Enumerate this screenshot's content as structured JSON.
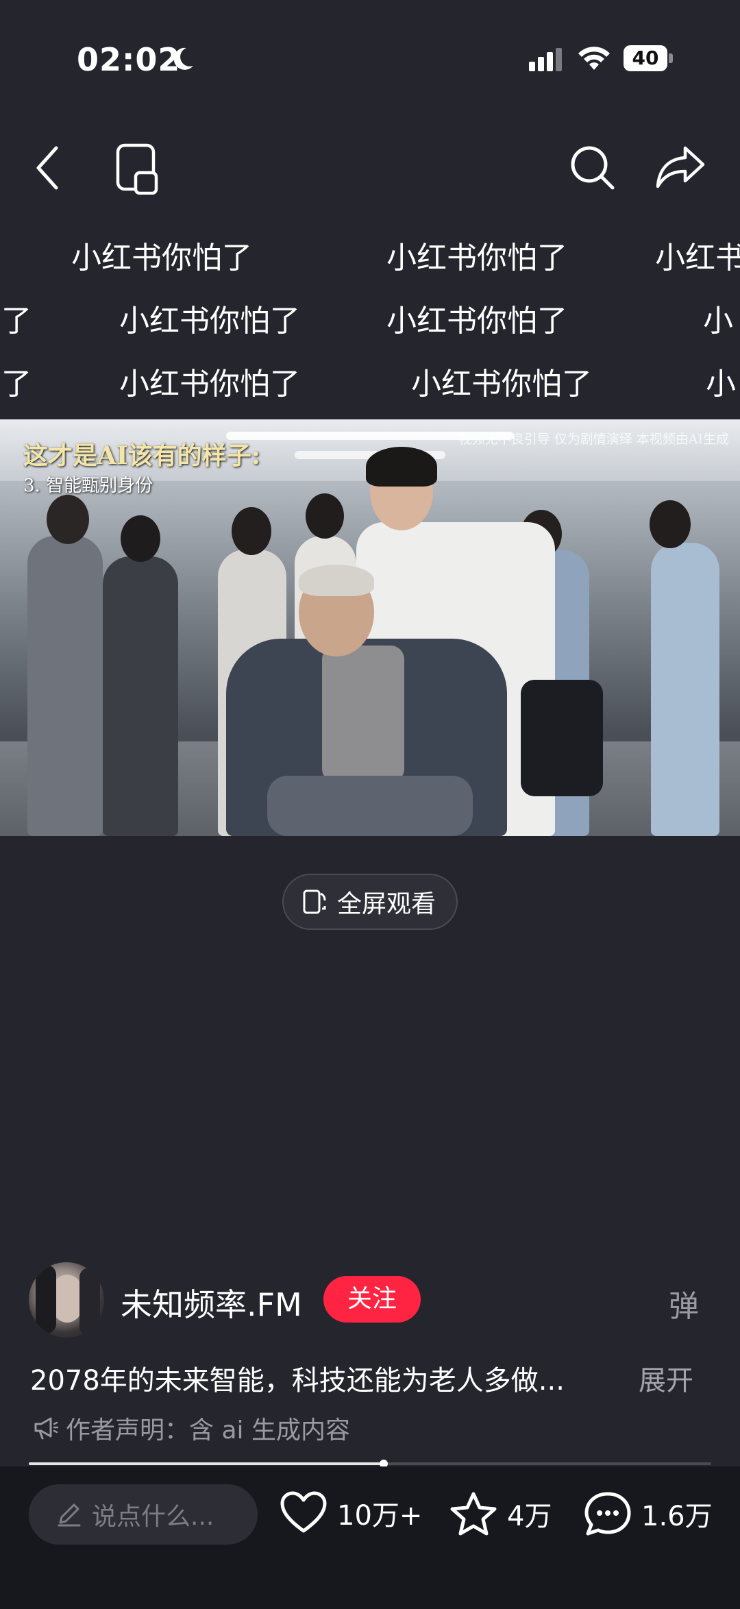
{
  "status_bar": {
    "time": "02:02",
    "battery": "40"
  },
  "watermark": {
    "text": "小红书你怕了",
    "fragment": "怕了",
    "edge": "小红书",
    "edge_short": "小"
  },
  "video": {
    "title": "这才是AI该有的样子:",
    "subtitle": "3. 智能甄别身份",
    "disclaimer": "视频无不良引导 仅为剧情演绎 本视频由AI生成"
  },
  "fullscreen_button": {
    "label": "全屏观看"
  },
  "author": {
    "name": "未知频率.FM",
    "follow_label": "关注",
    "danmu_label": "弹"
  },
  "post": {
    "description": "2078年的未来智能，科技还能为老人多做...",
    "expand_label": "展开",
    "notice": "作者声明：含 ai 生成内容"
  },
  "progress": {
    "played_fraction": 0.52
  },
  "bottom_bar": {
    "comment_placeholder": "说点什么...",
    "likes": "10万+",
    "collects": "4万",
    "comments": "1.6万"
  },
  "colors": {
    "background": "#24252d",
    "accent": "#ff2442",
    "bottom_bar": "#17181d"
  }
}
